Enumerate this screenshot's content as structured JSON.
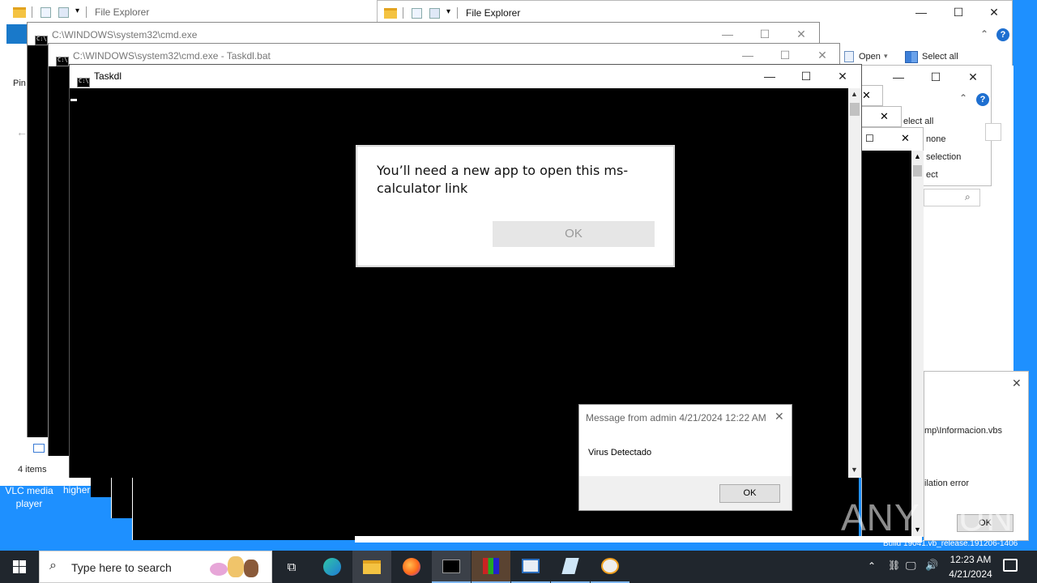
{
  "explorer_left": {
    "title": "File Explorer",
    "pin_label": "Pin",
    "items_count": "4 items"
  },
  "explorer_right": {
    "title": "File Explorer",
    "open_label": "Open",
    "select_all_label": "Select all",
    "select_all_partial": "elect all",
    "select_none_partial": "none",
    "invert_partial": "selection",
    "select_partial": "ect"
  },
  "cmd1": {
    "title": "C:\\WINDOWS\\system32\\cmd.exe"
  },
  "cmd2": {
    "title": "C:\\WINDOWS\\system32\\cmd.exe - Taskdl.bat"
  },
  "taskdl": {
    "title": "Taskdl"
  },
  "new_app_dialog": {
    "message": "You’ll need a new app to open this ms-calculator link",
    "ok_label": "OK"
  },
  "message_box": {
    "title": "Message from admin 4/21/2024 12:22 AM",
    "body": "Virus Detectado",
    "ok_label": "OK"
  },
  "script_error": {
    "path_partial": "mp\\Informacion.vbs",
    "error_partial": "ilation error",
    "ok_label": "OK"
  },
  "desktop": {
    "vlc_label": "VLC media player",
    "higher_partial": "higher"
  },
  "watermark": {
    "text": "ANY RUN"
  },
  "build_text": "Build 19041.vb_release.191206-1406",
  "taskbar": {
    "search_placeholder": "Type here to search",
    "time": "12:23 AM",
    "date": "4/21/2024"
  },
  "colors": {
    "desktop": "#1e90ff",
    "taskbar": "#20262d",
    "accent": "#0078d7"
  }
}
